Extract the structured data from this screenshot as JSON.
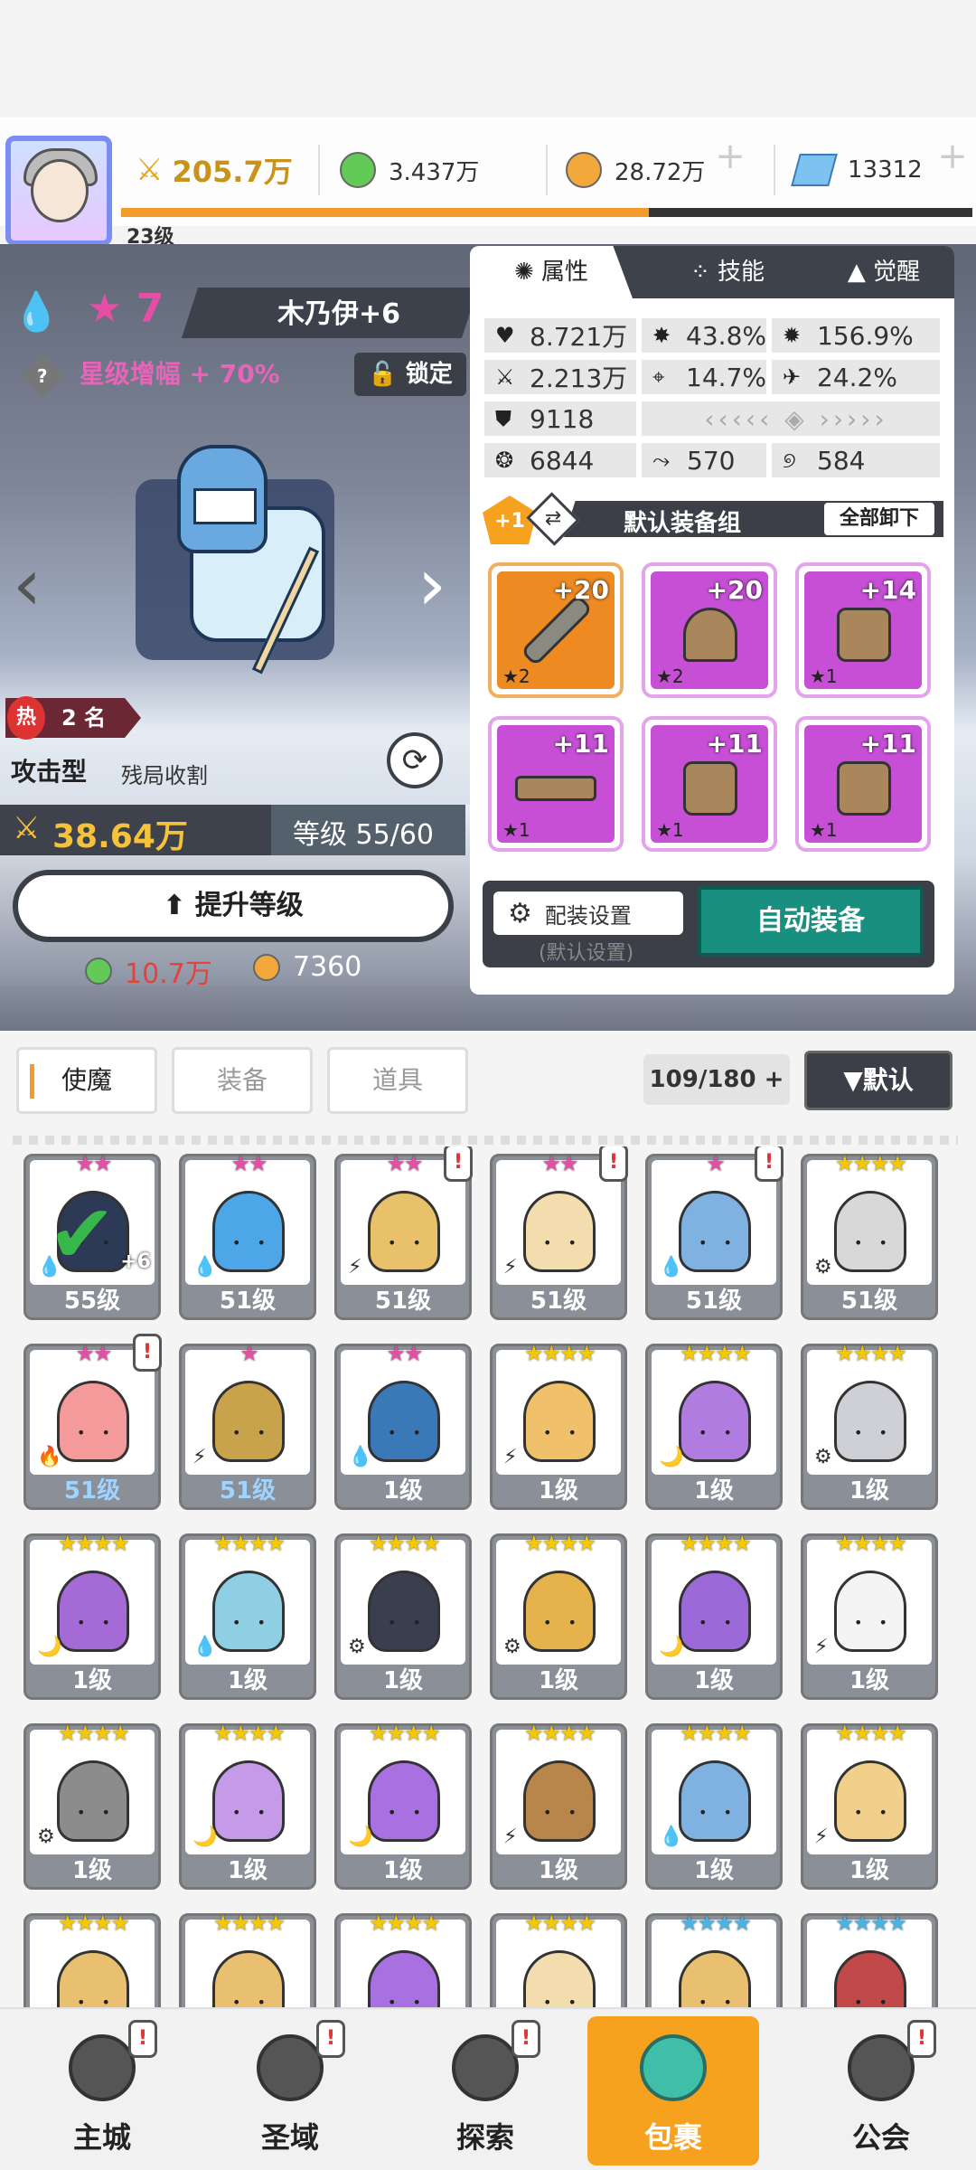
{
  "player": {
    "level": "23级"
  },
  "resources": {
    "power": "205.7万",
    "green": "3.437万",
    "gold": "28.72万",
    "gem": "13312",
    "exp_progress": 0.62
  },
  "hero": {
    "star": "7",
    "name": "木乃伊+6",
    "bonus": "星级增幅 + 70%",
    "lock": "锁定",
    "hot_label": "热",
    "rank": "2 名",
    "type": "攻击型",
    "role": "残局收割",
    "power": "38.64万",
    "level": "等级 55/60",
    "upgrade": "提升等级",
    "cost_green": "10.7万",
    "cost_gold": "7360"
  },
  "panel": {
    "tabs": [
      "属性",
      "技能",
      "觉醒"
    ],
    "stats": {
      "hp": "8.721万",
      "crit": "43.8%",
      "crit_dmg": "156.9%",
      "atk": "2.213万",
      "acc": "14.7%",
      "speed": "24.2%",
      "def": "9118",
      "s1": "6844",
      "s2": "570",
      "s3": "584"
    },
    "equip_badge": "+1",
    "equip_set": "默认装备组",
    "unequip_all": "全部卸下",
    "slots": [
      {
        "plus": "+20",
        "stars": "★2",
        "kind": "sword",
        "rarity": "orange"
      },
      {
        "plus": "+20",
        "stars": "★2",
        "kind": "helmet",
        "rarity": "purple"
      },
      {
        "plus": "+14",
        "stars": "★1",
        "kind": "armor",
        "rarity": "purple"
      },
      {
        "plus": "+11",
        "stars": "★1",
        "kind": "belt",
        "rarity": "purple"
      },
      {
        "plus": "+11",
        "stars": "★1",
        "kind": "necklace",
        "rarity": "purple"
      },
      {
        "plus": "+11",
        "stars": "★1",
        "kind": "boots",
        "rarity": "purple"
      }
    ],
    "config": "配装设置",
    "config_sub": "(默认设置)",
    "auto_equip": "自动装备"
  },
  "filters": {
    "tabs": [
      "使魔",
      "装备",
      "道具"
    ],
    "count": "109/180",
    "sort": "▼默认"
  },
  "cards": [
    {
      "lvl": "55级",
      "stars": "★★",
      "sc": "#e44ea5",
      "elem": "💧",
      "hair": "#2c3a55",
      "warn": false,
      "check": true,
      "plus": "+6"
    },
    {
      "lvl": "51级",
      "stars": "★★",
      "sc": "#e44ea5",
      "elem": "💧",
      "hair": "#4ca6e8",
      "warn": false
    },
    {
      "lvl": "51级",
      "stars": "★★",
      "sc": "#e44ea5",
      "elem": "⚡",
      "hair": "#e8c16a",
      "warn": true
    },
    {
      "lvl": "51级",
      "stars": "★★",
      "sc": "#e44ea5",
      "elem": "⚡",
      "hair": "#f3dcae",
      "warn": true
    },
    {
      "lvl": "51级",
      "stars": "★",
      "sc": "#e44ea5",
      "elem": "💧",
      "hair": "#7fb2e0",
      "warn": true
    },
    {
      "lvl": "51级",
      "stars": "★★★★",
      "sc": "#f5c800",
      "elem": "⚙",
      "hair": "#d8d8d8",
      "warn": false
    },
    {
      "lvl": "51级",
      "stars": "★★",
      "sc": "#e44ea5",
      "elem": "🔥",
      "hair": "#f49a9a",
      "warn": true,
      "blue": true
    },
    {
      "lvl": "51级",
      "stars": "★",
      "sc": "#e44ea5",
      "elem": "⚡",
      "hair": "#c9a24c",
      "warn": false,
      "blue": true
    },
    {
      "lvl": "1级",
      "stars": "★★",
      "sc": "#e44ea5",
      "elem": "💧",
      "hair": "#3b78b8",
      "warn": false
    },
    {
      "lvl": "1级",
      "stars": "★★★★",
      "sc": "#f5c800",
      "elem": "⚡",
      "hair": "#f0c06a",
      "warn": false
    },
    {
      "lvl": "1级",
      "stars": "★★★★",
      "sc": "#f5c800",
      "elem": "🌙",
      "hair": "#b07ce0",
      "warn": false
    },
    {
      "lvl": "1级",
      "stars": "★★★★",
      "sc": "#f5c800",
      "elem": "⚙",
      "hair": "#cfcfd6",
      "warn": false
    },
    {
      "lvl": "1级",
      "stars": "★★★★",
      "sc": "#f5c800",
      "elem": "🌙",
      "hair": "#a46ad6",
      "warn": false
    },
    {
      "lvl": "1级",
      "stars": "★★★★",
      "sc": "#f5c800",
      "elem": "💧",
      "hair": "#8ecfe4",
      "warn": false
    },
    {
      "lvl": "1级",
      "stars": "★★★★",
      "sc": "#f5c800",
      "elem": "⚙",
      "hair": "#3a3f50",
      "warn": false
    },
    {
      "lvl": "1级",
      "stars": "★★★★",
      "sc": "#f5c800",
      "elem": "⚙",
      "hair": "#e6b24c",
      "warn": false
    },
    {
      "lvl": "1级",
      "stars": "★★★★",
      "sc": "#f5c800",
      "elem": "🌙",
      "hair": "#9b6ad8",
      "warn": false
    },
    {
      "lvl": "1级",
      "stars": "★★★★",
      "sc": "#f5c800",
      "elem": "⚡",
      "hair": "#f4f4f4",
      "warn": false
    },
    {
      "lvl": "1级",
      "stars": "★★★★",
      "sc": "#f5c800",
      "elem": "⚙",
      "hair": "#8c8c8c",
      "warn": false
    },
    {
      "lvl": "1级",
      "stars": "★★★★",
      "sc": "#f5c800",
      "elem": "🌙",
      "hair": "#c59ae8",
      "warn": false
    },
    {
      "lvl": "1级",
      "stars": "★★★★",
      "sc": "#f5c800",
      "elem": "🌙",
      "hair": "#a870e0",
      "warn": false
    },
    {
      "lvl": "1级",
      "stars": "★★★★",
      "sc": "#f5c800",
      "elem": "⚡",
      "hair": "#b8864a",
      "warn": false
    },
    {
      "lvl": "1级",
      "stars": "★★★★",
      "sc": "#f5c800",
      "elem": "💧",
      "hair": "#7fb2e0",
      "warn": false
    },
    {
      "lvl": "1级",
      "stars": "★★★★",
      "sc": "#f5c800",
      "elem": "⚡",
      "hair": "#f0d08a",
      "warn": false
    },
    {
      "lvl": "",
      "stars": "★★★★",
      "sc": "#f5c800",
      "elem": "",
      "hair": "#e8c070",
      "warn": false
    },
    {
      "lvl": "",
      "stars": "★★★★",
      "sc": "#f5c800",
      "elem": "",
      "hair": "#e8c070",
      "warn": false
    },
    {
      "lvl": "",
      "stars": "★★★★",
      "sc": "#f5c800",
      "elem": "",
      "hair": "#a870e0",
      "warn": false
    },
    {
      "lvl": "",
      "stars": "★★★★",
      "sc": "#f5c800",
      "elem": "",
      "hair": "#f3dcae",
      "warn": false
    },
    {
      "lvl": "",
      "stars": "★★★★",
      "sc": "#4ab3e6",
      "elem": "",
      "hair": "#e8c070",
      "warn": false
    },
    {
      "lvl": "",
      "stars": "★★★★",
      "sc": "#4ab3e6",
      "elem": "",
      "hair": "#c04848",
      "warn": false
    }
  ],
  "nav": [
    {
      "label": "主城",
      "warn": true
    },
    {
      "label": "圣域",
      "warn": true
    },
    {
      "label": "探索",
      "warn": true
    },
    {
      "label": "包裹",
      "warn": false,
      "active": true
    },
    {
      "label": "公会",
      "warn": true
    }
  ],
  "warn_mark": "!"
}
